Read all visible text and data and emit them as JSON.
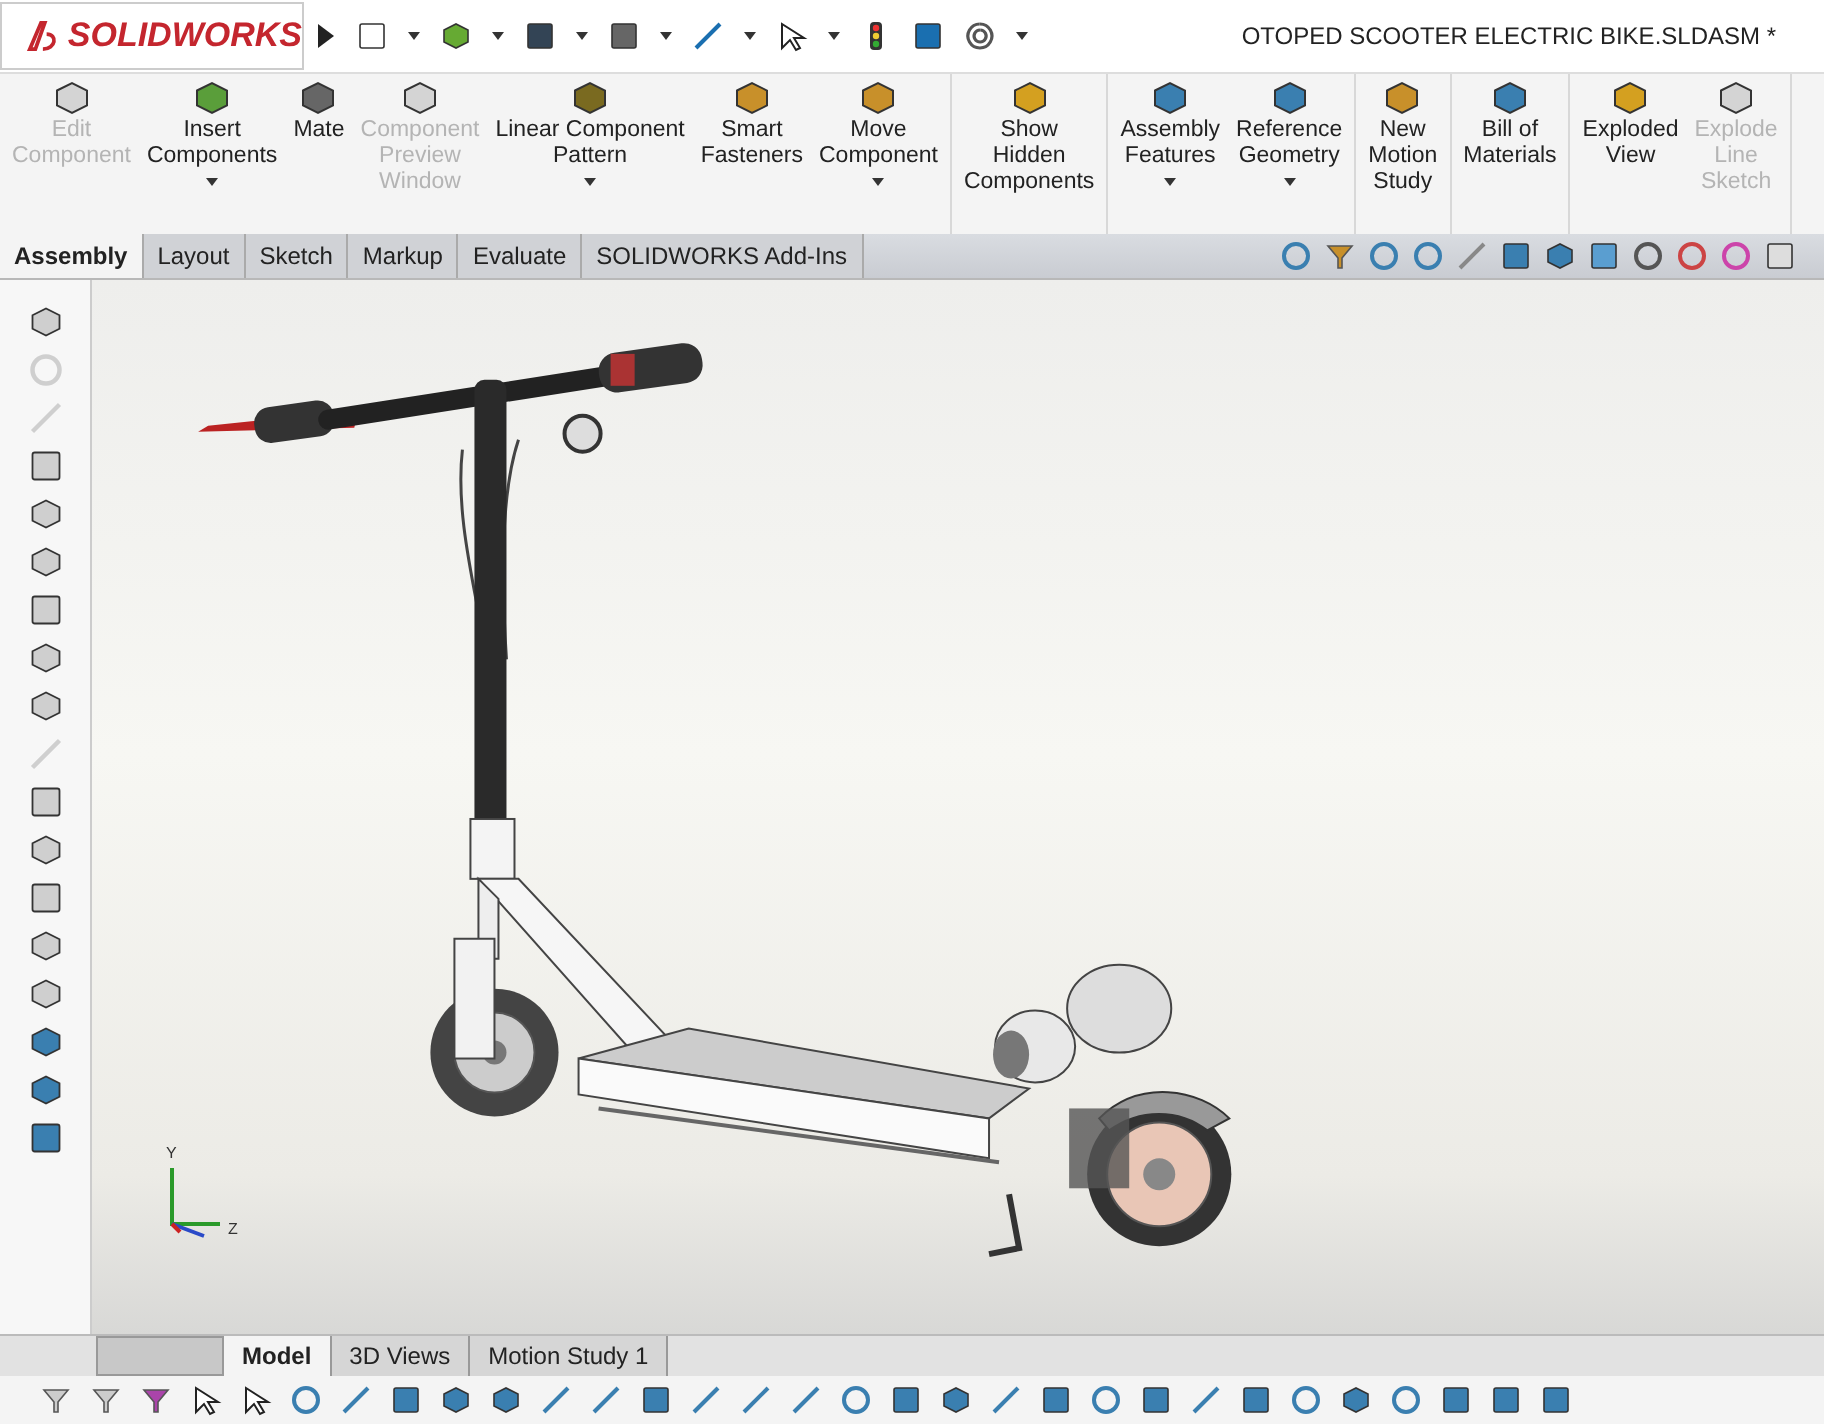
{
  "app": {
    "logo": "SOLIDWORKS"
  },
  "document": {
    "title": "OTOPED SCOOTER ELECTRIC BIKE.SLDASM *"
  },
  "ribbon": {
    "groups": [
      {
        "items": [
          {
            "label": "Edit\nComponent",
            "disabled": true,
            "dropdown": false
          },
          {
            "label": "Insert\nComponents",
            "disabled": false,
            "dropdown": true
          },
          {
            "label": "Mate",
            "disabled": false,
            "dropdown": false
          },
          {
            "label": "Component\nPreview\nWindow",
            "disabled": true,
            "dropdown": false
          },
          {
            "label": "Linear Component\nPattern",
            "disabled": false,
            "dropdown": true
          },
          {
            "label": "Smart\nFasteners",
            "disabled": false,
            "dropdown": false
          },
          {
            "label": "Move\nComponent",
            "disabled": false,
            "dropdown": true
          }
        ]
      },
      {
        "items": [
          {
            "label": "Show\nHidden\nComponents",
            "disabled": false,
            "dropdown": false
          }
        ]
      },
      {
        "items": [
          {
            "label": "Assembly\nFeatures",
            "disabled": false,
            "dropdown": true
          },
          {
            "label": "Reference\nGeometry",
            "disabled": false,
            "dropdown": true
          }
        ]
      },
      {
        "items": [
          {
            "label": "New\nMotion\nStudy",
            "disabled": false,
            "dropdown": false
          }
        ]
      },
      {
        "items": [
          {
            "label": "Bill of\nMaterials",
            "disabled": false,
            "dropdown": false
          }
        ]
      },
      {
        "items": [
          {
            "label": "Exploded\nView",
            "disabled": false,
            "dropdown": false
          },
          {
            "label": "Explode\nLine\nSketch",
            "disabled": true,
            "dropdown": false
          }
        ]
      }
    ]
  },
  "tabs": [
    {
      "label": "Assembly",
      "selected": true
    },
    {
      "label": "Layout",
      "selected": false
    },
    {
      "label": "Sketch",
      "selected": false
    },
    {
      "label": "Markup",
      "selected": false
    },
    {
      "label": "Evaluate",
      "selected": false
    },
    {
      "label": "SOLIDWORKS Add-Ins",
      "selected": false
    }
  ],
  "triad": {
    "y_label": "Y",
    "z_label": "Z"
  },
  "bottom_tabs": [
    {
      "label": "Model",
      "selected": true
    },
    {
      "label": "3D Views",
      "selected": false
    },
    {
      "label": "Motion Study 1",
      "selected": false
    }
  ]
}
